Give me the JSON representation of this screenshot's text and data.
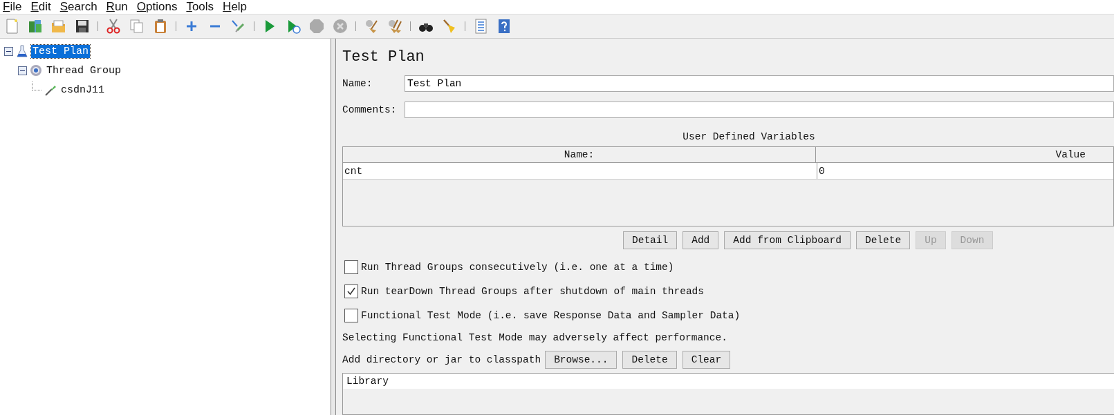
{
  "menu": [
    {
      "label": "File"
    },
    {
      "label": "Edit"
    },
    {
      "label": "Search"
    },
    {
      "label": "Run"
    },
    {
      "label": "Options"
    },
    {
      "label": "Tools"
    },
    {
      "label": "Help"
    }
  ],
  "tree": [
    {
      "label": "Test Plan",
      "kind": "plan",
      "selected": true,
      "expanded": true,
      "children": [
        {
          "label": "Thread Group",
          "kind": "group",
          "selected": false,
          "expanded": true,
          "children": [
            {
              "label": "csdnJ11",
              "kind": "sampler",
              "selected": false
            }
          ]
        }
      ]
    }
  ],
  "panel": {
    "title": "Test Plan",
    "name_label": "Name:",
    "name_value": "Test Plan",
    "comments_label": "Comments:",
    "variables": {
      "title": "User Defined Variables",
      "columns": [
        "Name:",
        "Value"
      ],
      "rows": [
        [
          "cnt",
          "0"
        ]
      ]
    },
    "table_buttons": [
      {
        "label": "Detail",
        "disabled": false
      },
      {
        "label": "Add",
        "disabled": false
      },
      {
        "label": "Add from Clipboard",
        "disabled": false
      },
      {
        "label": "Delete",
        "disabled": false
      },
      {
        "label": "Up",
        "disabled": true
      },
      {
        "label": "Down",
        "disabled": true
      }
    ],
    "options": [
      {
        "label": "Run Thread Groups consecutively (i.e. one at a time)",
        "checked": false
      },
      {
        "label": "Run tearDown Thread Groups after shutdown of main threads",
        "checked": true
      },
      {
        "label": "Functional Test Mode (i.e. save Response Data and Sampler Data)",
        "checked": false
      }
    ],
    "note": "Selecting Functional Test Mode may adversely affect performance.",
    "classpath_label": "Add directory or jar to classpath",
    "classpath_buttons": [
      "Browse...",
      "Delete",
      "Clear"
    ],
    "library_header": "Library"
  }
}
